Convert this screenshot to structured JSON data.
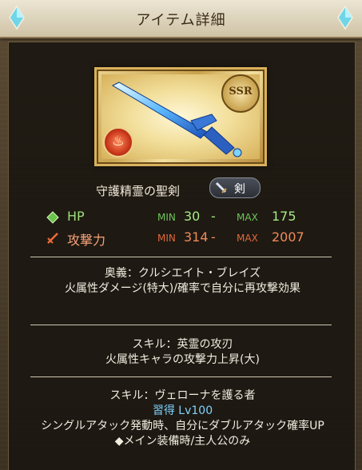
{
  "header": {
    "title": "アイテム詳細"
  },
  "item": {
    "name": "守護精霊の聖剣",
    "rarity": "SSR",
    "element_icon": "fire-element-icon",
    "type_icon": "sword-icon",
    "type_label": "剣"
  },
  "stats": {
    "hp": {
      "label": "HP",
      "min_label": "MIN",
      "min": "30",
      "sep": "-",
      "max_label": "MAX",
      "max": "175"
    },
    "atk": {
      "label": "攻撃力",
      "min_label": "MIN",
      "min": "314",
      "sep": "-",
      "max_label": "MAX",
      "max": "2007"
    }
  },
  "ougi": {
    "title": "奥義：クルシエイト・ブレイズ",
    "desc": "火属性ダメージ(特大)/確率で自分に再攻撃効果"
  },
  "skill1": {
    "title": "スキル：英霊の攻刃",
    "desc": "火属性キャラの攻撃力上昇(大)"
  },
  "skill2": {
    "title": "スキル：ヴェローナを護る者",
    "learn": "習得 Lv100",
    "desc": "シングルアタック発動時、自分にダブルアタック確率UP　◆メイン装備時/主人公のみ"
  },
  "colors": {
    "hp": "#9fe07a",
    "atk": "#f08a5a",
    "learn": "#7fd3ff",
    "frame_gold": "#d9b15c"
  }
}
